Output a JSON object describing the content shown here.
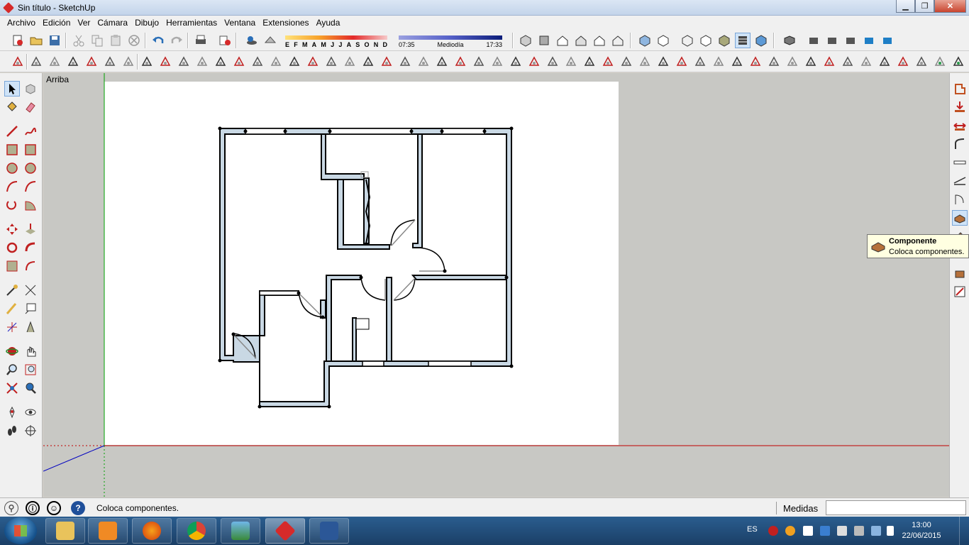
{
  "window": {
    "title": "Sin título - SketchUp",
    "controls": {
      "minimize": "▁",
      "maximize": "❐",
      "close": "✕"
    }
  },
  "menu": [
    "Archivo",
    "Edición",
    "Ver",
    "Cámara",
    "Dibujo",
    "Herramientas",
    "Ventana",
    "Extensiones",
    "Ayuda"
  ],
  "shadows": {
    "months": [
      "E",
      "F",
      "M",
      "A",
      "M",
      "J",
      "J",
      "A",
      "S",
      "O",
      "N",
      "D"
    ],
    "time_start": "07:35",
    "time_mid": "Mediodía",
    "time_end": "17:33"
  },
  "viewport": {
    "view_name": "Arriba"
  },
  "tooltip": {
    "title": "Componente",
    "text": "Coloca componentes."
  },
  "status": {
    "hint": "Coloca componentes.",
    "measures_label": "Medidas",
    "measures_value": ""
  },
  "taskbar": {
    "language": "ES",
    "time": "13:00",
    "date": "22/06/2015"
  },
  "colors": {
    "accent": "#0c1d7a",
    "wall_fill": "#c9d8e4",
    "red_axis": "#c00000",
    "green_axis": "#00a000",
    "blue_axis": "#0000c0"
  }
}
